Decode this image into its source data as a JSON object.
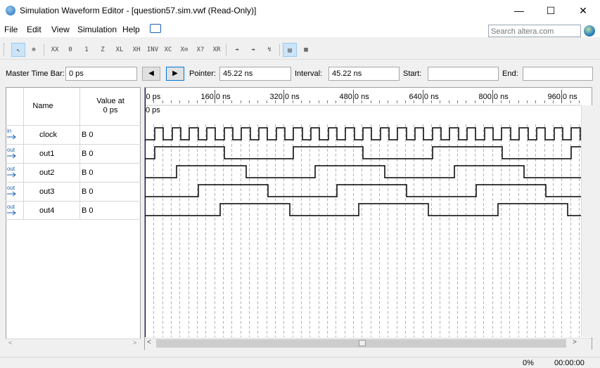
{
  "window": {
    "title": "Simulation Waveform Editor - [question57.sim.vwf (Read-Only)]",
    "minimize": "—",
    "maximize": "☐",
    "close": "✕"
  },
  "menu": [
    "File",
    "Edit",
    "View",
    "Simulation",
    "Help"
  ],
  "search_placeholder": "Search altera.com",
  "toolbar": {
    "icons": [
      "selection-tool-icon",
      "zoom-tool-icon",
      "x-value-icon",
      "zero-value-icon",
      "one-value-icon",
      "z-value-icon",
      "low-value-icon",
      "high-value-icon",
      "invert-icon",
      "count-value-icon",
      "clock-value-icon",
      "random-value-icon",
      "weak-value-icon",
      "dont-care-icon",
      "snap-icon",
      "snap-grid-icon",
      "overwrite-icon",
      "grid-toggle-icon",
      "group-icon"
    ]
  },
  "infobar": {
    "master_time_bar_label": "Master Time Bar:",
    "master_time_bar_value": "0 ps",
    "prev_label": "◀",
    "next_label": "▶",
    "pointer_label": "Pointer:",
    "pointer_value": "45.22 ns",
    "interval_label": "Interval:",
    "interval_value": "45.22 ns",
    "start_label": "Start:",
    "start_value": "",
    "end_label": "End:",
    "end_value": ""
  },
  "table": {
    "name_header": "Name",
    "value_header_1": "Value at",
    "value_header_2": "0 ps",
    "signals": [
      {
        "type": "in",
        "name": "clock",
        "value": "B 0"
      },
      {
        "type": "out",
        "name": "out1",
        "value": "B 0"
      },
      {
        "type": "out",
        "name": "out2",
        "value": "B 0"
      },
      {
        "type": "out",
        "name": "out3",
        "value": "B 0"
      },
      {
        "type": "out",
        "name": "out4",
        "value": "B 0"
      }
    ]
  },
  "timeline": {
    "ticks": [
      "0 ps",
      "160.0 ns",
      "320.0 ns",
      "480.0 ns",
      "640.0 ns",
      "800.0 ns",
      "960.0 ns"
    ],
    "cursor_label": "0 ps"
  },
  "status": {
    "progress": "0%",
    "elapsed": "00:00:00"
  }
}
